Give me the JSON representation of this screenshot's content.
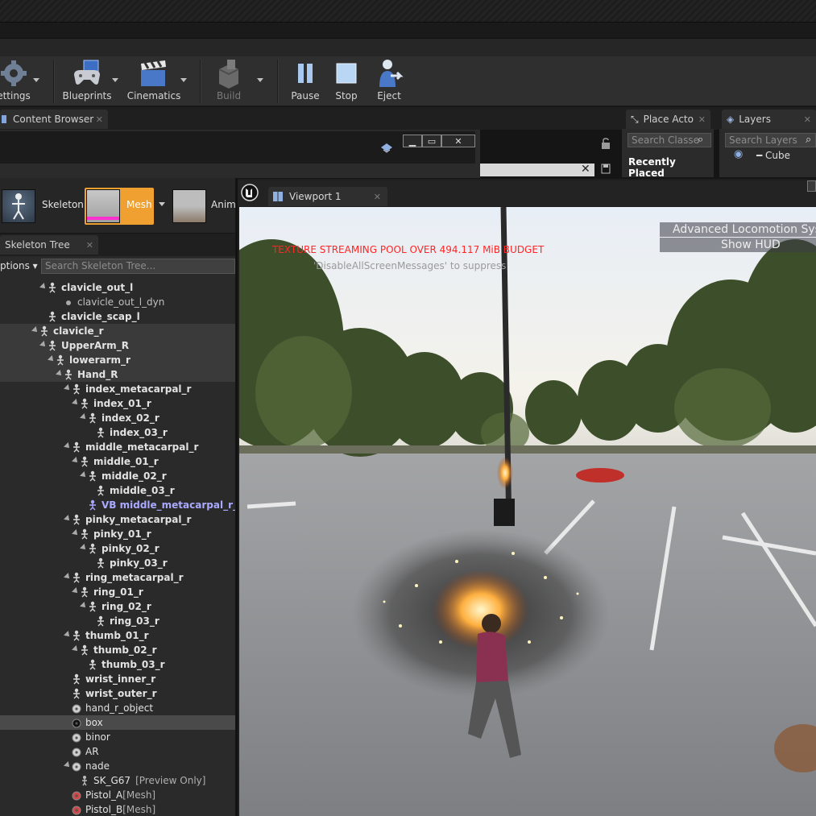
{
  "toolbar": {
    "items": [
      {
        "label": "ettings",
        "icon": "gear-icon"
      },
      {
        "label": "Blueprints",
        "icon": "blueprint-gamepad-icon"
      },
      {
        "label": "Cinematics",
        "icon": "clapperboard-icon"
      },
      {
        "label": "Build",
        "icon": "build-blocks-icon",
        "disabled": true
      },
      {
        "label": "Pause",
        "icon": "pause-icon"
      },
      {
        "label": "Stop",
        "icon": "stop-icon"
      },
      {
        "label": "Eject",
        "icon": "eject-person-icon"
      }
    ]
  },
  "tabs": {
    "content_browser": "Content Browser",
    "place_actors": "Place Acto",
    "layers": "Layers"
  },
  "place_panel": {
    "search_placeholder": "Search Classe",
    "recently_placed": "Recently Placed"
  },
  "layers_panel": {
    "search_placeholder": "Search Layers",
    "items": [
      "Cube"
    ]
  },
  "persona": {
    "modes": [
      {
        "label": "Skeleton",
        "active": false
      },
      {
        "label": "Mesh",
        "active": true
      },
      {
        "label": "Anim",
        "active": false
      }
    ]
  },
  "skeleton_tree": {
    "tab_label": "Skeleton Tree",
    "options_label": "ptions",
    "search_placeholder": "Search Skeleton Tree...",
    "rows": [
      {
        "name": "clavicle_out_l",
        "depth": 6,
        "type": "bone",
        "expand": true,
        "bold": true
      },
      {
        "name": "clavicle_out_l_dyn",
        "depth": 8,
        "type": "dot",
        "bold": false,
        "dim": true
      },
      {
        "name": "clavicle_scap_l",
        "depth": 6,
        "type": "bone",
        "expand": false,
        "bold": true
      },
      {
        "name": "clavicle_r",
        "depth": 5,
        "type": "bone",
        "expand": true,
        "bold": true,
        "sel": true
      },
      {
        "name": "UpperArm_R",
        "depth": 6,
        "type": "bone",
        "expand": true,
        "bold": true,
        "sel": true
      },
      {
        "name": "lowerarm_r",
        "depth": 7,
        "type": "bone",
        "expand": true,
        "bold": true,
        "sel": true
      },
      {
        "name": "Hand_R",
        "depth": 8,
        "type": "bone",
        "expand": true,
        "bold": true,
        "sel": true
      },
      {
        "name": "index_metacarpal_r",
        "depth": 9,
        "type": "bone",
        "expand": true,
        "bold": true
      },
      {
        "name": "index_01_r",
        "depth": 10,
        "type": "bone",
        "expand": true,
        "bold": true
      },
      {
        "name": "index_02_r",
        "depth": 11,
        "type": "bone",
        "expand": true,
        "bold": true
      },
      {
        "name": "index_03_r",
        "depth": 12,
        "type": "bone",
        "expand": false,
        "bold": true
      },
      {
        "name": "middle_metacarpal_r",
        "depth": 9,
        "type": "bone",
        "expand": true,
        "bold": true
      },
      {
        "name": "middle_01_r",
        "depth": 10,
        "type": "bone",
        "expand": true,
        "bold": true
      },
      {
        "name": "middle_02_r",
        "depth": 11,
        "type": "bone",
        "expand": true,
        "bold": true
      },
      {
        "name": "middle_03_r",
        "depth": 12,
        "type": "bone",
        "expand": false,
        "bold": true
      },
      {
        "name": "VB middle_metacarpal_r_mid",
        "depth": 11,
        "type": "vbone",
        "expand": false,
        "bold": true,
        "vb": true
      },
      {
        "name": "pinky_metacarpal_r",
        "depth": 9,
        "type": "bone",
        "expand": true,
        "bold": true
      },
      {
        "name": "pinky_01_r",
        "depth": 10,
        "type": "bone",
        "expand": true,
        "bold": true
      },
      {
        "name": "pinky_02_r",
        "depth": 11,
        "type": "bone",
        "expand": true,
        "bold": true
      },
      {
        "name": "pinky_03_r",
        "depth": 12,
        "type": "bone",
        "expand": false,
        "bold": true
      },
      {
        "name": "ring_metacarpal_r",
        "depth": 9,
        "type": "bone",
        "expand": true,
        "bold": true
      },
      {
        "name": "ring_01_r",
        "depth": 10,
        "type": "bone",
        "expand": true,
        "bold": true
      },
      {
        "name": "ring_02_r",
        "depth": 11,
        "type": "bone",
        "expand": true,
        "bold": true
      },
      {
        "name": "ring_03_r",
        "depth": 12,
        "type": "bone",
        "expand": false,
        "bold": true
      },
      {
        "name": "thumb_01_r",
        "depth": 9,
        "type": "bone",
        "expand": true,
        "bold": true
      },
      {
        "name": "thumb_02_r",
        "depth": 10,
        "type": "bone",
        "expand": true,
        "bold": true
      },
      {
        "name": "thumb_03_r",
        "depth": 11,
        "type": "bone",
        "expand": false,
        "bold": true
      },
      {
        "name": "wrist_inner_r",
        "depth": 9,
        "type": "bone",
        "expand": false,
        "bold": true
      },
      {
        "name": "wrist_outer_r",
        "depth": 9,
        "type": "bone",
        "expand": false,
        "bold": true
      },
      {
        "name": "hand_r_object",
        "depth": 9,
        "type": "socket",
        "expand": false,
        "bold": false
      },
      {
        "name": "box",
        "depth": 9,
        "type": "socket-dark",
        "expand": false,
        "bold": false,
        "hi": true
      },
      {
        "name": "binor",
        "depth": 9,
        "type": "socket",
        "expand": false,
        "bold": false
      },
      {
        "name": "AR",
        "depth": 9,
        "type": "socket",
        "expand": false,
        "bold": false
      },
      {
        "name": "nade",
        "depth": 9,
        "type": "socket",
        "expand": true,
        "bold": false
      },
      {
        "name": "SK_G67",
        "suffix": "[Preview Only]",
        "depth": 10,
        "type": "figure",
        "expand": false,
        "bold": false
      },
      {
        "name": "Pistol_A",
        "suffix": "[Mesh]",
        "depth": 9,
        "type": "socket-red",
        "expand": false,
        "bold": false
      },
      {
        "name": "Pistol_B",
        "suffix": "[Mesh]",
        "depth": 9,
        "type": "socket-red",
        "expand": false,
        "bold": false
      }
    ]
  },
  "viewport": {
    "tab_label": "Viewport 1",
    "warning": "TEXTURE STREAMING POOL OVER 494.117 MiB BUDGET",
    "hint": "'DisableAllScreenMessages' to suppress",
    "als_title": "Advanced Locomotion Syste",
    "als_show_hud": "Show HUD"
  },
  "colors": {
    "accent_orange": "#f0a030",
    "warning_red": "#ff2626",
    "vbone_purple": "#a9a9ff"
  }
}
